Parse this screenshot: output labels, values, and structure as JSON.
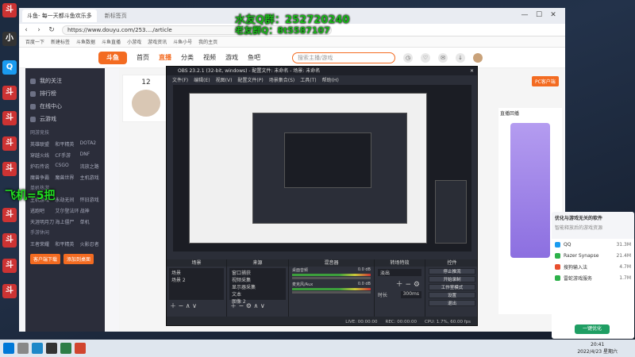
{
  "overlay": {
    "qq_group": "水友Q群：252720240",
    "qq_line2": "老友群Q：8t5587107",
    "plane_text": "飞机=5把"
  },
  "desktop_icons": [
    "斗",
    "小",
    "Q",
    "斗",
    "斗",
    "斗",
    "斗",
    "斗",
    "斗",
    "斗",
    "斗"
  ],
  "browser": {
    "tabs": [
      "斗鱼- 每一天都斗鱼欢乐多",
      "新标签页"
    ],
    "url": "https://www.douyu.com/253..../article",
    "bookmarks": [
      "百度一下",
      "新建标签",
      "斗鱼数据",
      "斗鱼直播",
      "小游戏",
      "游戏资讯",
      "斗鱼小号",
      "我的主页"
    ],
    "nav": [
      "首页",
      "直播",
      "分类",
      "视频",
      "游戏",
      "鱼吧"
    ],
    "active_nav": "直播",
    "logo": "斗鱼",
    "search_placeholder": "搜索主播/游戏"
  },
  "sidebar": {
    "items": [
      "我的关注",
      "排行榜",
      "在线中心",
      "云游戏"
    ],
    "sections": [
      {
        "title": "网游竞技",
        "cells": [
          "英雄联盟",
          "和平精英",
          "DOTA2",
          "穿越火线",
          "CF手游",
          "DNF",
          "炉石传说",
          "CSGO",
          "流放之路",
          "魔兽争霸",
          "魔兽世界",
          "主机游戏"
        ]
      },
      {
        "title": "单机热游",
        "cells": [
          "主机游戏",
          "永劫无间",
          "怀旧游戏",
          "逃跑吧",
          "艾尔登法环",
          "战神",
          "天涯明月刀",
          "海上僵尸",
          "单机"
        ]
      },
      {
        "title": "手游休闲",
        "cells": [
          "王者荣耀",
          "和平精英",
          "火影忍者"
        ]
      }
    ],
    "buttons": [
      "客户端下载",
      "添加到桌面"
    ]
  },
  "page": {
    "stream_count": "12",
    "right_title": "直播回播",
    "pc_client": "PC客户端"
  },
  "obs": {
    "title": "OBS 23.2.1 (32-bit, windows) - 配置文件: 未命名 - 场景: 未命名",
    "menu": [
      "文件(F)",
      "编辑(E)",
      "视图(V)",
      "配置文件(P)",
      "场景集合(S)",
      "工具(T)",
      "帮助(H)"
    ],
    "docks": {
      "scenes": {
        "title": "场景",
        "items": [
          "场景",
          "场景 2"
        ]
      },
      "sources": {
        "title": "来源",
        "items": [
          "窗口捕获",
          "视频采集",
          "显示器采集",
          "文本",
          "图像 2"
        ]
      },
      "mixer": {
        "title": "混音器",
        "tracks": [
          {
            "name": "桌面音频",
            "db": "0.0 dB"
          },
          {
            "name": "麦克风/Aux",
            "db": "0.0 dB"
          }
        ]
      },
      "transitions": {
        "title": "转场特效",
        "type": "淡出",
        "duration_label": "时长",
        "duration": "300ms"
      },
      "controls": {
        "title": "控件",
        "buttons": [
          "停止推流",
          "开始录制",
          "工作室模式",
          "设置",
          "退出"
        ]
      }
    },
    "status": [
      "LIVE: 00:00:00",
      "REC: 00:00:00",
      "CPU: 1.7%, 60.00 fps"
    ]
  },
  "popup": {
    "title": "优化与游戏无关的软件",
    "subtitle": "智能释放后的游戏资源",
    "apps": [
      {
        "name": "QQ",
        "mb": "31.3M",
        "color": "#1a9bf0"
      },
      {
        "name": "Razer Synapse",
        "mb": "21.4M",
        "color": "#2db14a"
      },
      {
        "name": "搜狗输入法",
        "mb": "4.7M",
        "color": "#e84f2e"
      },
      {
        "name": "雷蛇游戏服务",
        "mb": "1.7M",
        "color": "#2db14a"
      }
    ],
    "button": "一键优化"
  },
  "taskbar": {
    "time": "20:41",
    "date": "2022/4/23 星期六"
  }
}
